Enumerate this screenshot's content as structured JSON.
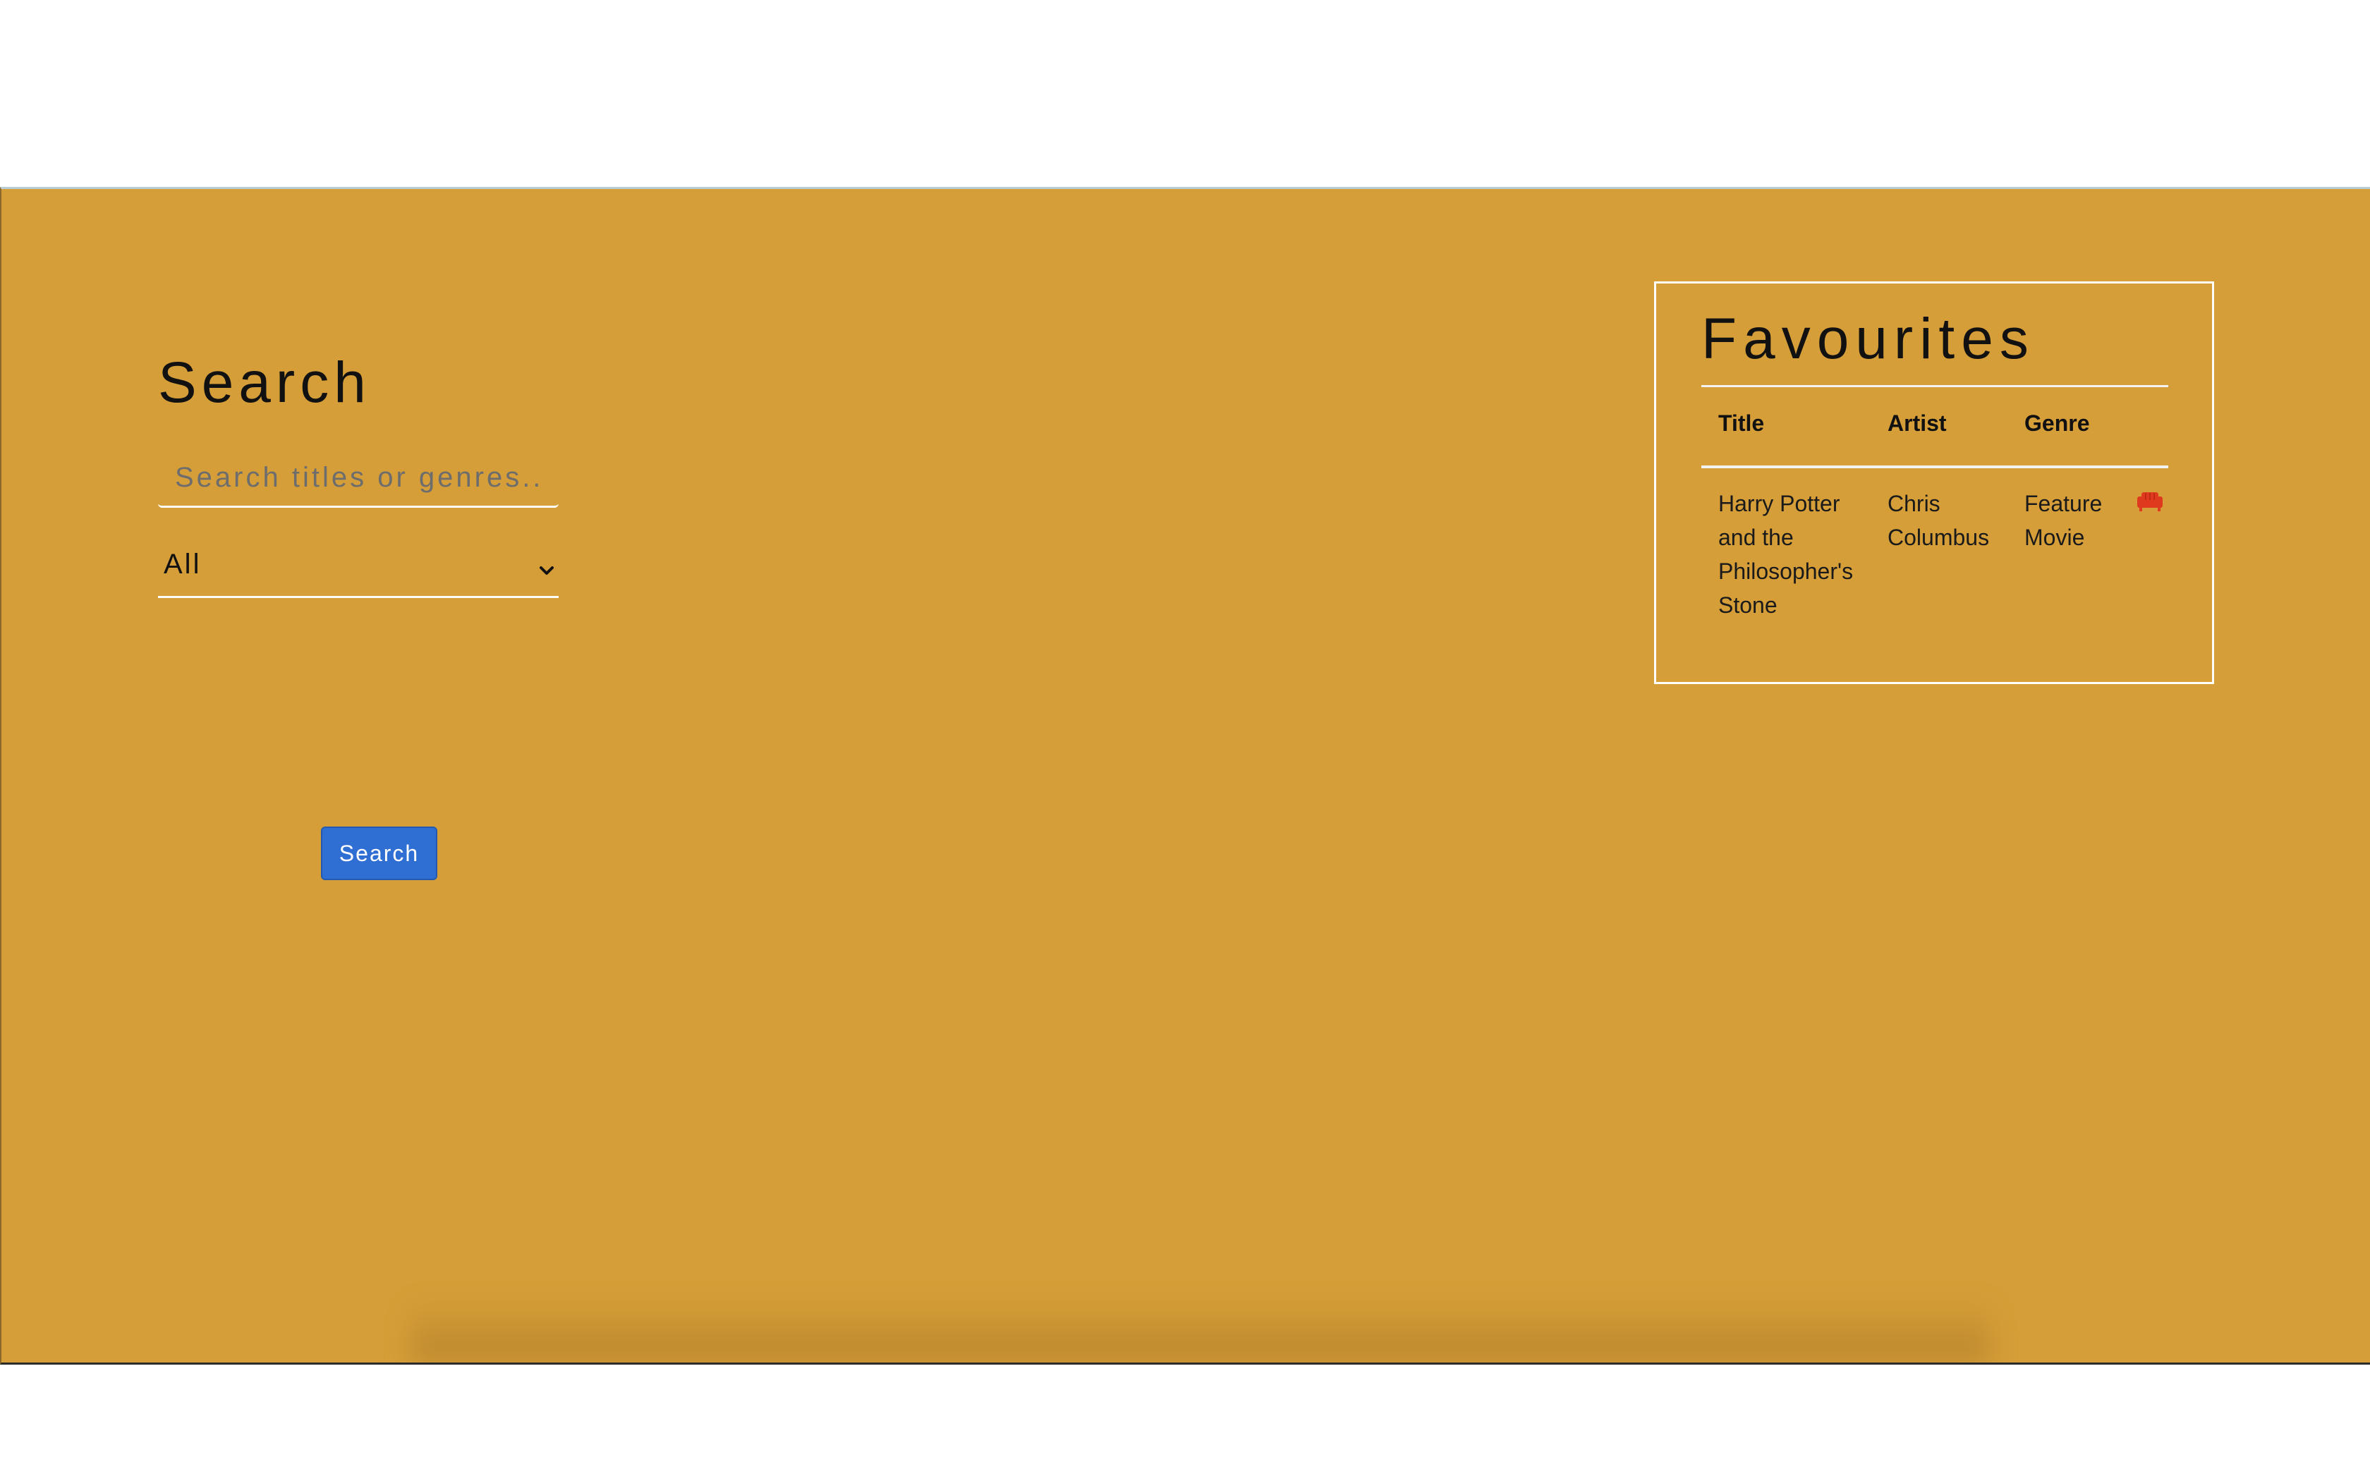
{
  "search": {
    "heading": "Search",
    "input_value": "",
    "placeholder": "Search titles or genres..",
    "filter_selected": "All",
    "button_label": "Search"
  },
  "favourites": {
    "heading": "Favourites",
    "columns": [
      "Title",
      "Artist",
      "Genre"
    ],
    "rows": [
      {
        "title_lines": [
          "Harry Potter",
          "and the",
          "Philosopher's",
          "Stone"
        ],
        "artist_lines": [
          "Chris",
          "Columbus"
        ],
        "genre_lines": [
          "Feature",
          "Movie"
        ],
        "action_icon": "sofa-icon"
      }
    ]
  },
  "colors": {
    "panel_background": "#d69e38",
    "button_background": "#2f6fd3",
    "action_icon_color": "#e03a1e"
  }
}
